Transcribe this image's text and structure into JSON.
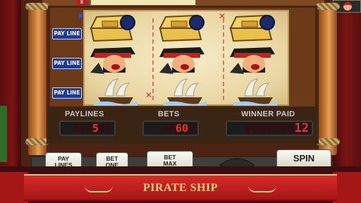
{
  "game": {
    "title": "PIRATE SHIP",
    "top_close_label": "X"
  },
  "paylines": {
    "button_label": "PAY LINE",
    "rows": 3
  },
  "reels": {
    "rows": [
      [
        "treasure-chest",
        "treasure-chest",
        "treasure-chest"
      ],
      [
        "pirate-captain",
        "pirate-captain",
        "pirate-captain"
      ],
      [
        "sailing-ship",
        "sailing-ship",
        "sailing-ship"
      ]
    ]
  },
  "panel": {
    "paylines_label": "PAYLINES",
    "paylines_value": "5",
    "bets_label": "BETS",
    "bets_value": "60",
    "winner_paid_label": "WINNER PAID",
    "winner_paid_value": "12"
  },
  "buttons": {
    "pay_lines_1": "PAY",
    "pay_lines_2": "LINES",
    "bet_one_1": "BET",
    "bet_one_2": "ONE",
    "bet_max_1": "BET",
    "bet_max_2": "MAX",
    "spin": "SPIN"
  },
  "colors": {
    "banner": "#c21f1f",
    "display_digits": "#ff2a2a",
    "payline_button": "#1d3a9a"
  }
}
